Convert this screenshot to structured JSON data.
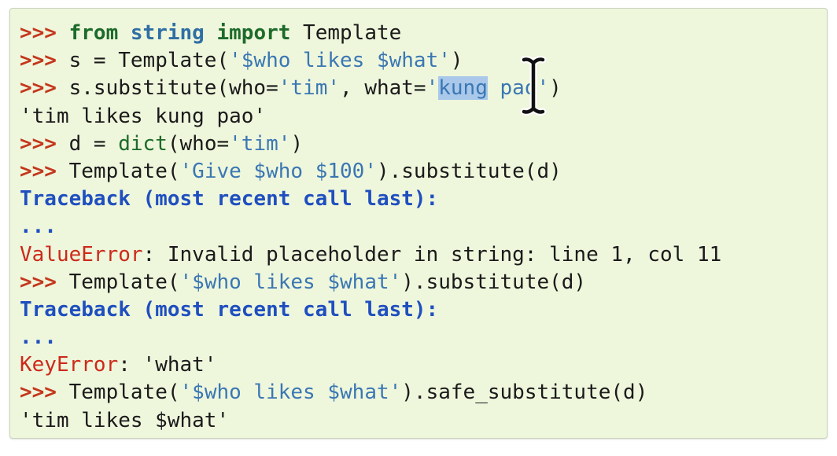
{
  "lines": [
    {
      "segments": [
        {
          "t": ">>> ",
          "c": "pr"
        },
        {
          "t": "from",
          "c": "kw"
        },
        {
          "t": " "
        },
        {
          "t": "string",
          "c": "mod"
        },
        {
          "t": " "
        },
        {
          "t": "import",
          "c": "kw"
        },
        {
          "t": " Template"
        }
      ]
    },
    {
      "segments": [
        {
          "t": ">>> ",
          "c": "pr"
        },
        {
          "t": "s = Template("
        },
        {
          "t": "'$who likes $what'",
          "c": "str"
        },
        {
          "t": ")"
        }
      ]
    },
    {
      "segments": [
        {
          "t": ">>> ",
          "c": "pr"
        },
        {
          "t": "s.substitute(who="
        },
        {
          "t": "'tim'",
          "c": "str"
        },
        {
          "t": ", what="
        },
        {
          "t": "'",
          "c": "str"
        },
        {
          "t": "kung",
          "c": "str sel"
        },
        {
          "t": " pao'",
          "c": "str"
        },
        {
          "t": ")"
        }
      ]
    },
    {
      "segments": [
        {
          "t": "'tim likes kung pao'"
        }
      ]
    },
    {
      "segments": [
        {
          "t": ">>> ",
          "c": "pr"
        },
        {
          "t": "d = "
        },
        {
          "t": "dict",
          "c": "bi"
        },
        {
          "t": "(who="
        },
        {
          "t": "'tim'",
          "c": "str"
        },
        {
          "t": ")"
        }
      ]
    },
    {
      "segments": [
        {
          "t": ">>> ",
          "c": "pr"
        },
        {
          "t": "Template("
        },
        {
          "t": "'Give $who $100'",
          "c": "str"
        },
        {
          "t": ").substitute(d)"
        }
      ]
    },
    {
      "segments": [
        {
          "t": "Traceback (most recent call last):",
          "c": "tb"
        }
      ]
    },
    {
      "segments": [
        {
          "t": "...",
          "c": "dots"
        }
      ]
    },
    {
      "segments": [
        {
          "t": "ValueError",
          "c": "err"
        },
        {
          "t": ": Invalid placeholder in string: line 1, col 11"
        }
      ]
    },
    {
      "segments": [
        {
          "t": ">>> ",
          "c": "pr"
        },
        {
          "t": "Template("
        },
        {
          "t": "'$who likes $what'",
          "c": "str"
        },
        {
          "t": ").substitute(d)"
        }
      ]
    },
    {
      "segments": [
        {
          "t": "Traceback (most recent call last):",
          "c": "tb"
        }
      ]
    },
    {
      "segments": [
        {
          "t": "...",
          "c": "dots"
        }
      ]
    },
    {
      "segments": [
        {
          "t": "KeyError",
          "c": "err"
        },
        {
          "t": ": 'what'"
        }
      ]
    },
    {
      "segments": [
        {
          "t": ">>> ",
          "c": "pr"
        },
        {
          "t": "Template("
        },
        {
          "t": "'$who likes $what'",
          "c": "str"
        },
        {
          "t": ").safe_substitute(d)"
        }
      ]
    },
    {
      "segments": [
        {
          "t": "'tim likes $what'"
        }
      ]
    }
  ],
  "cursor_icon": "text-cursor-icon",
  "colors": {
    "panel_background": "#eef6dc",
    "prompt": "#c4361b",
    "keyword": "#1c6b2a",
    "string": "#3a77b3",
    "traceback": "#1f4fbf",
    "error": "#cc2a1a",
    "selection": "#a9c8ea"
  }
}
